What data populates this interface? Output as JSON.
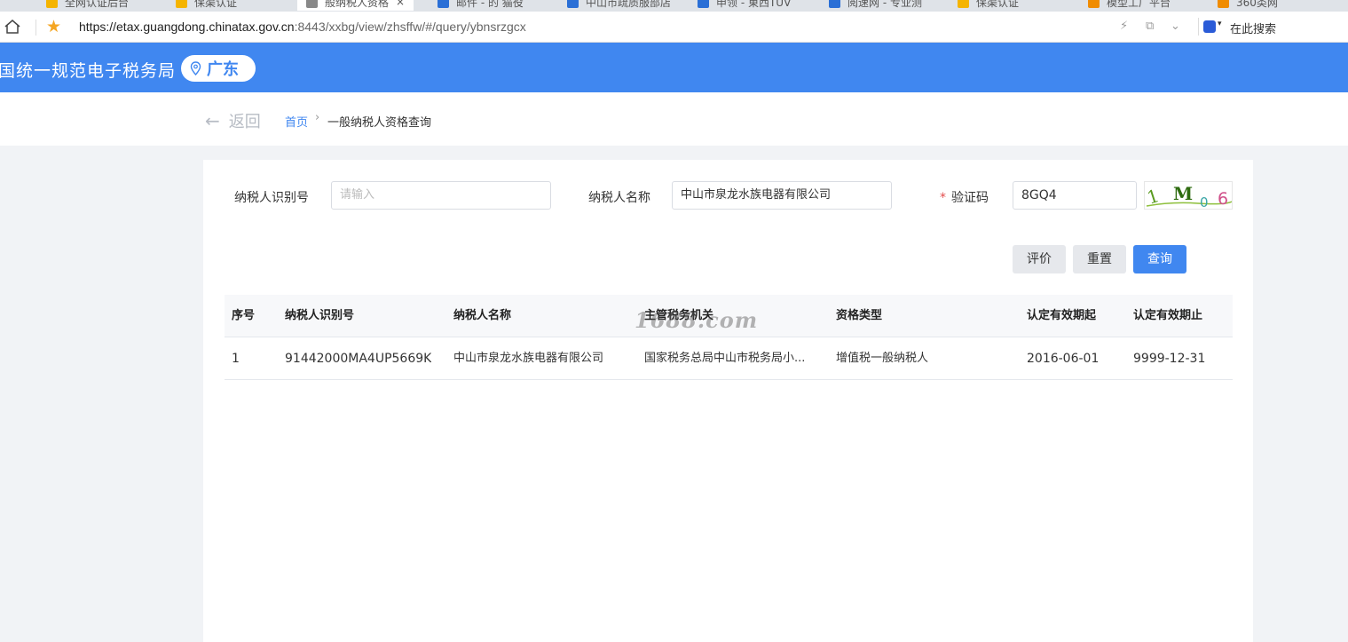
{
  "browser": {
    "tabs": [
      {
        "label": "全网认证后台",
        "color": "#f5b400"
      },
      {
        "label": "保渠认证",
        "color": "#f5b400"
      },
      {
        "label": "般纳税人资格",
        "color": "#888888",
        "close": "×"
      },
      {
        "label": "邮件 - 的 猫役",
        "color": "#2a6fd6"
      },
      {
        "label": "中山市疏质服部店",
        "color": "#2a6fd6"
      },
      {
        "label": "申领 - 東西TUV",
        "color": "#2a6fd6"
      },
      {
        "label": "阅速网 - 专业测",
        "color": "#2a6fd6"
      },
      {
        "label": "保渠认证",
        "color": "#f5b400"
      },
      {
        "label": "模型工厂平台",
        "color": "#f08c00"
      },
      {
        "label": "360类网",
        "color": "#f08c00"
      }
    ],
    "url_host": "https://etax.guangdong.chinatax.gov.cn",
    "url_rest": ":8443/xxbg/view/zhsffw/#/query/ybnsrzgcx",
    "search_label": "在此搜索"
  },
  "header": {
    "site_title": "国统一规范电子税务局",
    "region": "广东"
  },
  "breadcrumb": {
    "back": "返回",
    "home": "首页",
    "separator": "›",
    "current": "一般纳税人资格查询"
  },
  "form": {
    "taxpayer_id_label": "纳税人识别号",
    "taxpayer_id_placeholder": "请输入",
    "taxpayer_name_label": "纳税人名称",
    "taxpayer_name_value": "中山市泉龙水族电器有限公司",
    "required_mark": "*",
    "captcha_label": "验证码",
    "captcha_value": "8GQ4",
    "captcha_image_text": "1 M 0 6"
  },
  "buttons": {
    "evaluate": "评价",
    "reset": "重置",
    "query": "查询"
  },
  "table": {
    "columns": [
      "序号",
      "纳税人识别号",
      "纳税人名称",
      "主管税务机关",
      "资格类型",
      "认定有效期起",
      "认定有效期止"
    ],
    "rows": [
      [
        "1",
        "91442000MA4UP5669K",
        "中山市泉龙水族电器有限公司",
        "国家税务总局中山市税务局小...",
        "增值税一般纳税人",
        "2016-06-01",
        "9999-12-31"
      ]
    ]
  },
  "watermark": "1688.com",
  "colors": {
    "brand_blue": "#4087f0",
    "page_bg": "#f1f3f6",
    "required_red": "#e34d4d"
  }
}
